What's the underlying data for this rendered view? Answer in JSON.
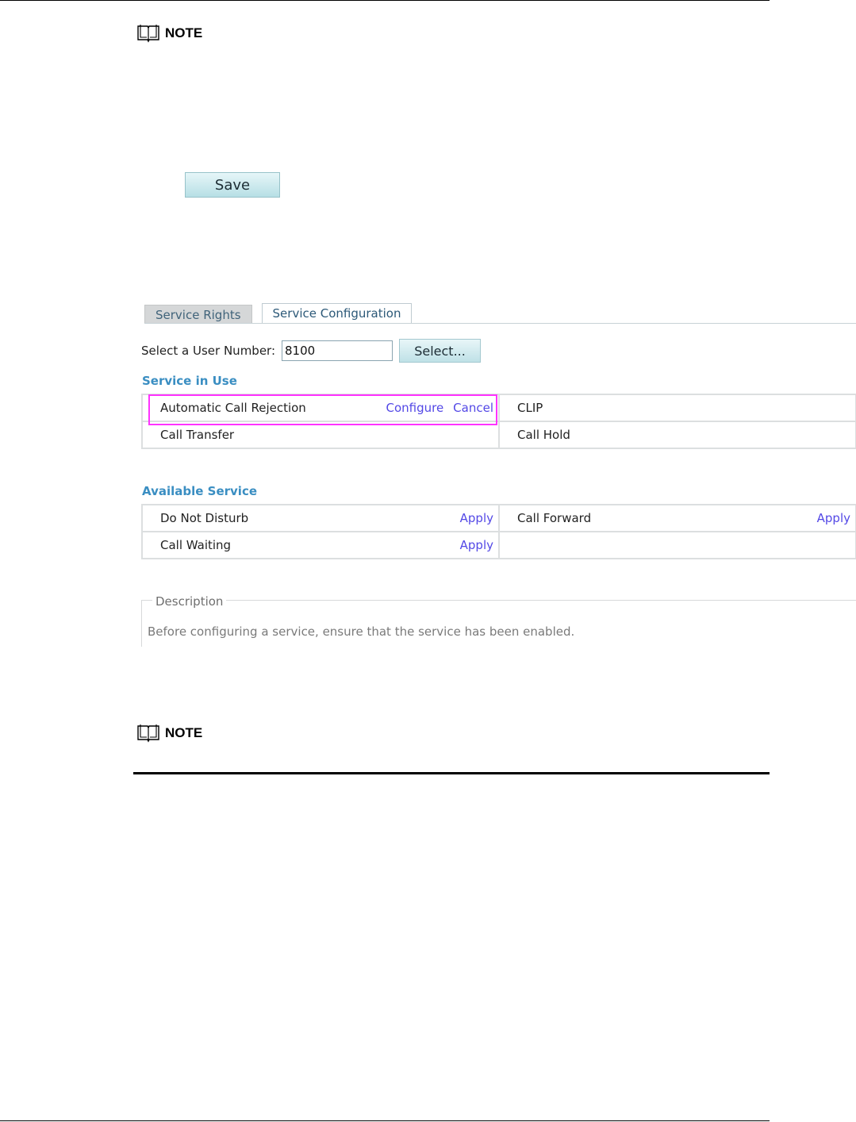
{
  "note_top": {
    "label": "NOTE"
  },
  "save_button": {
    "label": "Save"
  },
  "tabs": [
    {
      "label": "Service Rights",
      "active": false
    },
    {
      "label": "Service Configuration",
      "active": true
    }
  ],
  "user_select": {
    "label": "Select a User Number:",
    "value": "8100",
    "button": "Select..."
  },
  "service_in_use": {
    "title": "Service in Use",
    "rows": [
      {
        "left": {
          "name": "Automatic Call Rejection",
          "configure": "Configure",
          "cancel": "Cancel"
        },
        "right": {
          "name": "CLIP"
        }
      },
      {
        "left": {
          "name": "Call Transfer"
        },
        "right": {
          "name": "Call Hold"
        }
      }
    ]
  },
  "available_service": {
    "title": "Available Service",
    "rows": [
      {
        "left": {
          "name": "Do Not Disturb",
          "action": "Apply"
        },
        "right": {
          "name": "Call Forward",
          "action": "Apply"
        }
      },
      {
        "left": {
          "name": "Call Waiting",
          "action": "Apply"
        },
        "right": {
          "name": ""
        }
      }
    ]
  },
  "description": {
    "legend": "Description",
    "text": "Before configuring a service, ensure that the service has been enabled."
  },
  "note_bottom": {
    "label": "NOTE"
  },
  "highlight_color": "#ff33ff",
  "link_color": "#5348e6",
  "section_title_color": "#3a8ec2"
}
